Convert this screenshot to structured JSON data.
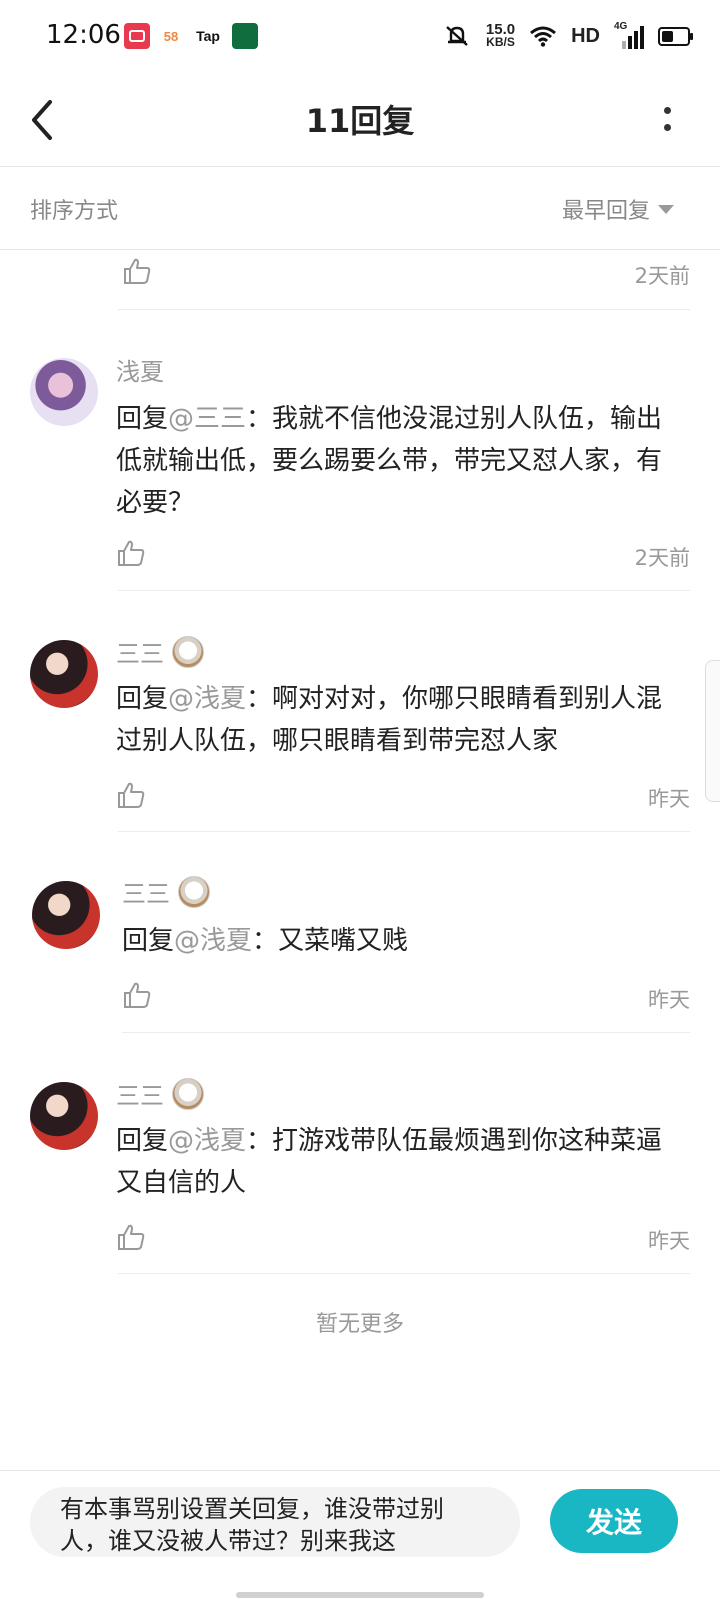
{
  "status_bar": {
    "time": "12:06",
    "notifications": [
      {
        "icon": "video-app-icon",
        "label": ""
      },
      {
        "icon": "app-58-icon",
        "label": "58"
      },
      {
        "icon": "taptap-icon",
        "label": "Tap"
      },
      {
        "icon": "bank-app-icon",
        "label": ""
      }
    ],
    "speed_value": "15.0",
    "speed_unit": "KB/S",
    "hd": "HD",
    "network": "4G",
    "battery_level": 0.45
  },
  "header": {
    "title": "11回复"
  },
  "sort": {
    "label": "排序方式",
    "selected": "最早回复"
  },
  "partial_item": {
    "time": "2天前"
  },
  "comments": [
    {
      "username": "浅夏",
      "has_badge": false,
      "prefix": "回复",
      "mention": "@三三",
      "colon": "：",
      "text": "我就不信他没混过别人队伍，输出低就输出低，要么踢要么带，带完又怼人家，有必要？",
      "time": "2天前"
    },
    {
      "username": "三三",
      "has_badge": true,
      "prefix": "回复",
      "mention": "@浅夏",
      "colon": "：",
      "text": "啊对对对，你哪只眼睛看到别人混过别人队伍，哪只眼睛看到带完怼人家",
      "time": "昨天"
    },
    {
      "username": "三三",
      "has_badge": true,
      "prefix": "回复",
      "mention": "@浅夏",
      "colon": "：",
      "text": "又菜嘴又贱",
      "time": "昨天"
    },
    {
      "username": "三三",
      "has_badge": true,
      "prefix": "回复",
      "mention": "@浅夏",
      "colon": "：",
      "text": "打游戏带队伍最烦遇到你这种菜逼又自信的人",
      "time": "昨天"
    }
  ],
  "no_more": "暂无更多",
  "reply_box": {
    "value": "有本事骂别设置关回复，谁没带过别人，谁又没被人带过？别来我这",
    "send_label": "发送"
  }
}
